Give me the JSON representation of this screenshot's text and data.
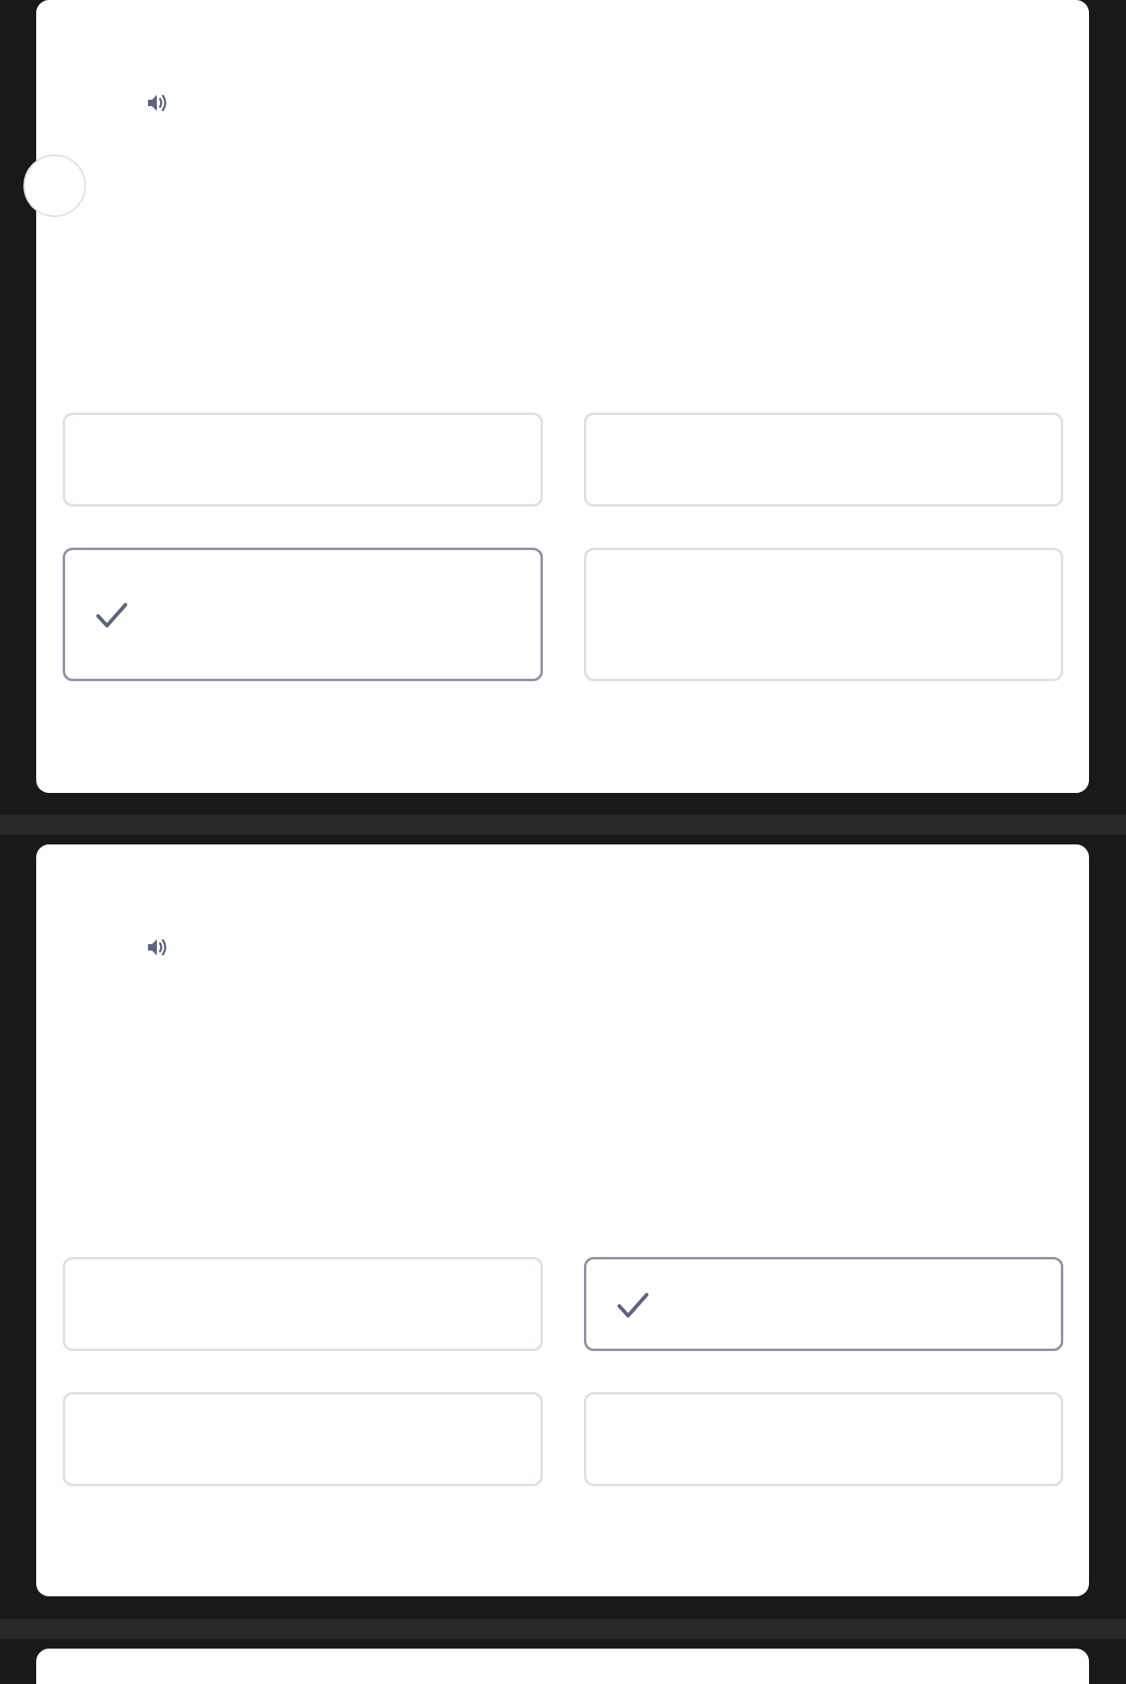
{
  "cards": [
    {
      "options": [
        {
          "selected": false
        },
        {
          "selected": false
        },
        {
          "selected": true
        },
        {
          "selected": false
        }
      ]
    },
    {
      "options": [
        {
          "selected": false
        },
        {
          "selected": true
        },
        {
          "selected": false
        },
        {
          "selected": false
        }
      ]
    }
  ]
}
